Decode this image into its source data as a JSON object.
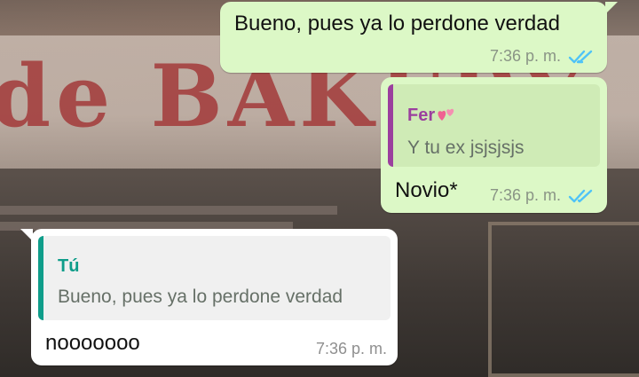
{
  "messages": [
    {
      "direction": "outgoing",
      "text": "Bueno, pues ya lo perdone verdad",
      "time": "7:36 p. m.",
      "status": "read"
    },
    {
      "direction": "outgoing",
      "quote": {
        "author": "Fer",
        "author_emoji": "two-hearts-icon",
        "text": "Y tu ex jsjsjsjs"
      },
      "text": "Novio*",
      "time": "7:36 p. m.",
      "status": "read"
    },
    {
      "direction": "incoming",
      "quote": {
        "author": "Tú",
        "text": "Bueno, pues ya lo perdone verdad"
      },
      "text": "nooooooo",
      "time": "7:36 p. m."
    }
  ],
  "colors": {
    "outgoing_bubble": "#dcf8c6",
    "incoming_bubble": "#ffffff",
    "read_ticks": "#4fc3f7",
    "quote_fer_accent": "#9b3f9e",
    "quote_tu_accent": "#0f9d8a"
  },
  "wallpaper": {
    "sign_text": "de BAKERY"
  }
}
